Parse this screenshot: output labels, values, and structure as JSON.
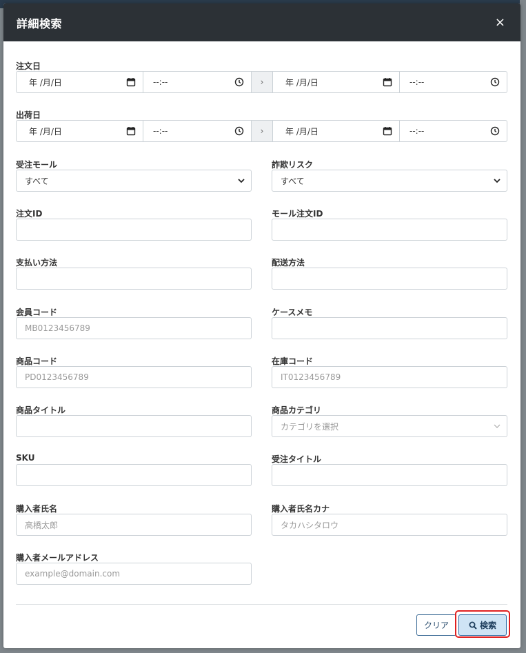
{
  "modal": {
    "title": "詳細検索",
    "close": "×"
  },
  "order_date": {
    "label": "注文日",
    "from_date": "年 /月/日",
    "from_time": "--:--",
    "separator": "›",
    "to_date": "年 /月/日",
    "to_time": "--:--"
  },
  "ship_date": {
    "label": "出荷日",
    "from_date": "年 /月/日",
    "from_time": "--:--",
    "separator": "›",
    "to_date": "年 /月/日",
    "to_time": "--:--"
  },
  "fields": {
    "mall": {
      "label": "受注モール",
      "value": "すべて"
    },
    "fraud_risk": {
      "label": "詐欺リスク",
      "value": "すべて"
    },
    "order_id": {
      "label": "注文ID",
      "placeholder": ""
    },
    "mall_order_id": {
      "label": "モール注文ID",
      "placeholder": ""
    },
    "payment_method": {
      "label": "支払い方法",
      "placeholder": ""
    },
    "shipping_method": {
      "label": "配送方法",
      "placeholder": ""
    },
    "member_code": {
      "label": "会員コード",
      "placeholder": "MB0123456789"
    },
    "case_memo": {
      "label": "ケースメモ",
      "placeholder": ""
    },
    "product_code": {
      "label": "商品コード",
      "placeholder": "PD0123456789"
    },
    "stock_code": {
      "label": "在庫コード",
      "placeholder": "IT0123456789"
    },
    "product_title": {
      "label": "商品タイトル",
      "placeholder": ""
    },
    "product_category": {
      "label": "商品カテゴリ",
      "placeholder": "カテゴリを選択"
    },
    "sku": {
      "label": "SKU",
      "placeholder": ""
    },
    "order_title": {
      "label": "受注タイトル",
      "placeholder": ""
    },
    "buyer_name": {
      "label": "購入者氏名",
      "placeholder": "高橋太郎"
    },
    "buyer_kana": {
      "label": "購入者氏名カナ",
      "placeholder": "タカハシタロウ"
    },
    "buyer_email": {
      "label": "購入者メールアドレス",
      "placeholder": "example@domain.com"
    }
  },
  "buttons": {
    "clear": "クリア",
    "search": "検索"
  },
  "colors": {
    "header_bg": "#2c3136",
    "accent_outline": "#e02020",
    "search_bg": "#cfe4f5"
  }
}
